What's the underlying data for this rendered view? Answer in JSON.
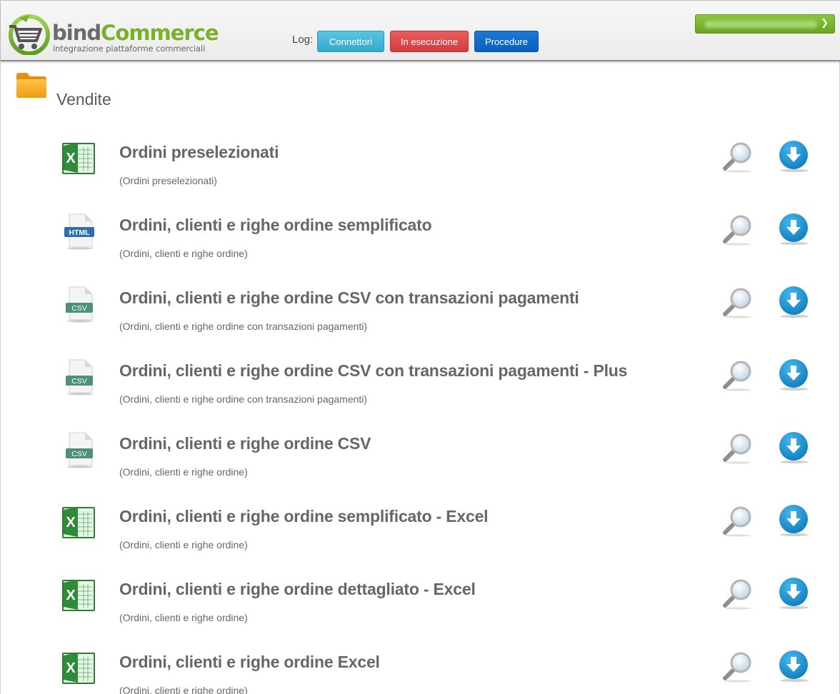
{
  "header": {
    "logo_text_part1": "bind",
    "logo_text_part2": "Commerce",
    "logo_subtitle": "integrazione piattaforme commerciali",
    "log_label": "Log:",
    "buttons": {
      "connettori": "Connettori",
      "in_esecuzione": "In esecuzione",
      "procedure": "Procedure"
    },
    "user_menu_value": "",
    "user_menu_icon": "chevron-down-icon"
  },
  "section": {
    "icon": "folder-icon",
    "title": "Vendite"
  },
  "items": [
    {
      "type": "excel",
      "title": "Ordini preselezionati",
      "subtitle": "(Ordini preselezionati)"
    },
    {
      "type": "html",
      "title": "Ordini, clienti e righe ordine semplificato",
      "subtitle": "(Ordini, clienti e righe ordine)"
    },
    {
      "type": "csv",
      "title": "Ordini, clienti e righe ordine CSV con transazioni pagamenti",
      "subtitle": "(Ordini, clienti e righe ordine con transazioni pagamenti)"
    },
    {
      "type": "csv",
      "title": "Ordini, clienti e righe ordine CSV con transazioni pagamenti - Plus",
      "subtitle": "(Ordini, clienti e righe ordine con transazioni pagamenti)"
    },
    {
      "type": "csv",
      "title": "Ordini, clienti e righe ordine CSV",
      "subtitle": "(Ordini, clienti e righe ordine)"
    },
    {
      "type": "excel",
      "title": "Ordini, clienti e righe ordine semplificato - Excel",
      "subtitle": "(Ordini, clienti e righe ordine)"
    },
    {
      "type": "excel",
      "title": "Ordini, clienti e righe ordine dettagliato - Excel",
      "subtitle": "(Ordini, clienti e righe ordine)"
    },
    {
      "type": "excel",
      "title": "Ordini, clienti e righe ordine Excel",
      "subtitle": "(Ordini, clienti e righe ordine)"
    }
  ],
  "file_icon_labels": {
    "html": "HTML",
    "csv": "CSV",
    "excel": "X"
  },
  "colors": {
    "brand_green": "#7bb02c",
    "connettori": "#3fb3d8",
    "in_esecuzione": "#df4848",
    "procedure": "#0f66c9",
    "download_blue": "#1596d6"
  }
}
